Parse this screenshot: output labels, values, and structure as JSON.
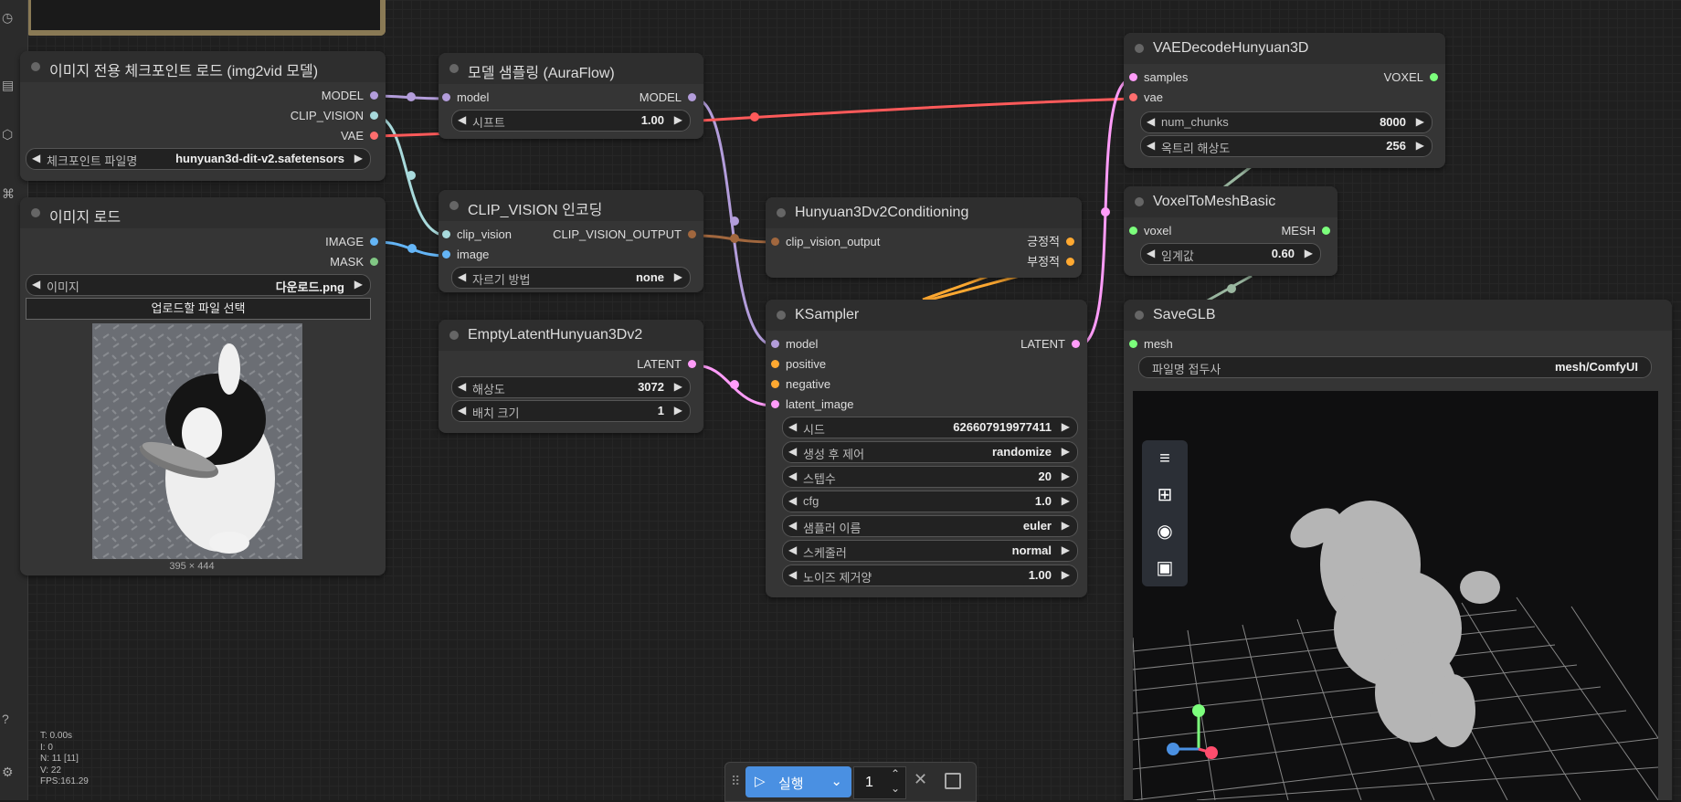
{
  "stats": {
    "t": "T: 0.00s",
    "i": "I: 0",
    "n": "N: 11 [11]",
    "v": "V: 22",
    "fps": "FPS:161.29"
  },
  "nodes": {
    "ckpt": {
      "title": "이미지 전용 체크포인트 로드 (img2vid 모델)",
      "outputs": [
        "MODEL",
        "CLIP_VISION",
        "VAE"
      ],
      "widget_label": "체크포인트 파일명",
      "widget_value": "hunyuan3d-dit-v2.safetensors"
    },
    "loadimage": {
      "title": "이미지 로드",
      "outputs": [
        "IMAGE",
        "MASK"
      ],
      "widget_label": "이미지",
      "widget_value": "다운로드.png",
      "upload_label": "업로드할 파일 선택",
      "size_caption": "395 × 444"
    },
    "sampling": {
      "title": "모델 샘플링 (AuraFlow)",
      "input": "model",
      "output": "MODEL",
      "widget_label": "시프트",
      "widget_value": "1.00"
    },
    "clipvision": {
      "title": "CLIP_VISION 인코딩",
      "inputs": [
        "clip_vision",
        "image"
      ],
      "output": "CLIP_VISION_OUTPUT",
      "widget_label": "자르기 방법",
      "widget_value": "none"
    },
    "emptylatent": {
      "title": "EmptyLatentHunyuan3Dv2",
      "output": "LATENT",
      "widgets": [
        {
          "label": "해상도",
          "value": "3072"
        },
        {
          "label": "배치 크기",
          "value": "1"
        }
      ]
    },
    "conditioning": {
      "title": "Hunyuan3Dv2Conditioning",
      "input": "clip_vision_output",
      "outputs": [
        "긍정적",
        "부정적"
      ]
    },
    "ksampler": {
      "title": "KSampler",
      "inputs": [
        "model",
        "positive",
        "negative",
        "latent_image"
      ],
      "output": "LATENT",
      "widgets": [
        {
          "label": "시드",
          "value": "626607919977411"
        },
        {
          "label": "생성 후 제어",
          "value": "randomize"
        },
        {
          "label": "스텝수",
          "value": "20"
        },
        {
          "label": "cfg",
          "value": "1.0"
        },
        {
          "label": "샘플러 이름",
          "value": "euler"
        },
        {
          "label": "스케줄러",
          "value": "normal"
        },
        {
          "label": "노이즈 제거양",
          "value": "1.00"
        }
      ]
    },
    "vaedecode": {
      "title": "VAEDecodeHunyuan3D",
      "inputs": [
        "samples",
        "vae"
      ],
      "output": "VOXEL",
      "widgets": [
        {
          "label": "num_chunks",
          "value": "8000"
        },
        {
          "label": "옥트리 해상도",
          "value": "256"
        }
      ]
    },
    "voxeltomesh": {
      "title": "VoxelToMeshBasic",
      "input": "voxel",
      "output": "MESH",
      "widget_label": "임계값",
      "widget_value": "0.60"
    },
    "saveglb": {
      "title": "SaveGLB",
      "input": "mesh",
      "widget_label": "파일명 접두사",
      "widget_value": "mesh/ComfyUI"
    }
  },
  "toolbar": {
    "run_label": "실행",
    "queue_count": "1"
  },
  "colors": {
    "model": "#b39ddb",
    "clip_vision": "#a8dadc",
    "vae": "#ff6e6e",
    "image": "#64b5f6",
    "mask": "#81c784",
    "latent": "#ff9cf9",
    "conditioning": "#ffa931",
    "clip_output": "#a1673e",
    "voxel": "#7cff7c",
    "accent": "#4a90e2"
  }
}
